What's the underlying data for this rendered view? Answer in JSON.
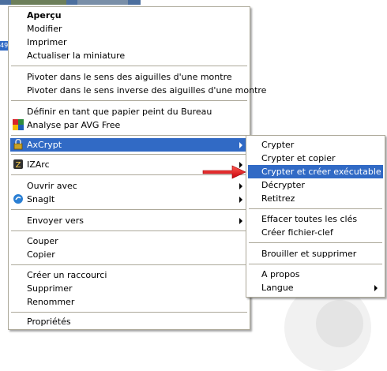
{
  "background": {
    "thumb_tag": "49"
  },
  "main_menu": {
    "items": [
      {
        "label": "Aperçu"
      },
      {
        "label": "Modifier"
      },
      {
        "label": "Imprimer"
      },
      {
        "label": "Actualiser la miniature"
      },
      {
        "label": "Pivoter dans le sens des aiguilles d'une montre"
      },
      {
        "label": "Pivoter dans le sens inverse des aiguilles d'une montre"
      },
      {
        "label": "Définir en tant que papier peint du Bureau"
      },
      {
        "label": "Analyse par AVG Free",
        "icon": "avg-icon"
      },
      {
        "label": "AxCrypt",
        "icon": "axcrypt-icon"
      },
      {
        "label": "IZArc",
        "icon": "izarc-icon"
      },
      {
        "label": "Ouvrir avec"
      },
      {
        "label": "SnagIt",
        "icon": "snagit-icon"
      },
      {
        "label": "Envoyer vers"
      },
      {
        "label": "Couper"
      },
      {
        "label": "Copier"
      },
      {
        "label": "Créer un raccourci"
      },
      {
        "label": "Supprimer"
      },
      {
        "label": "Renommer"
      },
      {
        "label": "Propriétés"
      }
    ]
  },
  "sub_menu": {
    "items": [
      {
        "label": "Crypter"
      },
      {
        "label": "Crypter et copier"
      },
      {
        "label": "Crypter et créer exécutable"
      },
      {
        "label": "Décrypter"
      },
      {
        "label": "Retitrez"
      },
      {
        "label": "Effacer toutes les clés"
      },
      {
        "label": "Créer fichier-clef"
      },
      {
        "label": "Brouiller et supprimer"
      },
      {
        "label": "A propos"
      },
      {
        "label": "Langue"
      }
    ]
  },
  "colors": {
    "highlight": "#316ac5",
    "pointer": "#e8141b",
    "border": "#aca899"
  }
}
